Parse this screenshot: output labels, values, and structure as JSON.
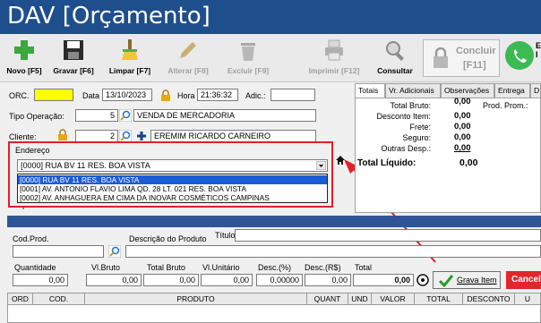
{
  "window": {
    "title": "DAV [Orçamento]"
  },
  "toolbar": {
    "novo": "Novo [F5]",
    "gravar": "Gravar [F6]",
    "limpar": "Limpar [F7]",
    "alterar": "Alterar [F8]",
    "excluir": "Excluir [F9]",
    "imprimir": "Imprimir [F12]",
    "consultar": "Consultar",
    "concluir_1": "Concluir",
    "concluir_2": "[F11]",
    "whatsapp_1": "E",
    "whatsapp_2": "I"
  },
  "form": {
    "orc_label": "ORC.",
    "orc_value": "",
    "data_label": "Data",
    "data_value": "13/10/2023",
    "hora_label": "Hora",
    "hora_value": "21:36:32",
    "adic_label": "Adic.:",
    "adic_value": "",
    "tipo_operacao_label": "Tipo Operação:",
    "tipo_operacao_code": "5",
    "tipo_operacao_desc": "VENDA DE MERCADORIA",
    "cliente_label": "Cliente:",
    "cliente_code": "2",
    "cliente_name": "EREMIM RICARDO CARNEIRO",
    "endereco_label": "Endereço",
    "endereco_selected": "[0000] RUA BV 11  RES. BOA VISTA",
    "endereco_options": [
      "[0000] RUA BV 11  RES. BOA VISTA",
      "[0001] AV. ANTONIO FLAVIO LIMA QD. 28 LT. 021 RES. BOA VISTA",
      "[0002] AV. ANHAGUERA EM CIMA DA INOVAR COSMÉTICOS CAMPINAS"
    ],
    "tipo_venda_label": "Tipo Venda:"
  },
  "tabs": {
    "items": [
      "Totais",
      "Vr. Adicionais",
      "Observações",
      "Entrega",
      "D"
    ],
    "total_bruto_label": "Total Bruto:",
    "total_bruto": "0,00",
    "prod_prom_label": "Prod. Prom.:",
    "desconto_item_label": "Desconto Item:",
    "desconto_item": "0,00",
    "frete_label": "Frete:",
    "frete": "0,00",
    "seguro_label": "Seguro:",
    "seguro": "0,00",
    "outras_label": "Outras Desp.:",
    "outras": "0,00",
    "total_liquido_label": "Total Líquido:",
    "total_liquido": "0,00"
  },
  "item": {
    "cod_prod_label": "Cod.Prod.",
    "descricao_label": "Descrição do Produto",
    "titulo_label": "Título",
    "quantidade_label": "Quantidade",
    "vl_bruto_label": "Vl.Bruto",
    "total_bruto_label": "Total Bruto",
    "vl_unitario_label": "Vl.Unitário",
    "desc_pct_label": "Desc.(%)",
    "desc_rs_label": "Desc.(R$)",
    "total_label": "Total",
    "quantidade": "0,00",
    "vl_bruto": "0,00",
    "total_bruto": "0,00",
    "vl_unitario": "0,00",
    "desc_pct": "0,00000",
    "desc_rs": "0,00",
    "total": "0,00",
    "grava_item": "Grava Item",
    "cancel": "Cancel"
  },
  "grid": {
    "columns": [
      "ORD",
      "COD.",
      "PRODUTO",
      "QUANT",
      "UND",
      "VALOR",
      "TOTAL",
      "DESCONTO",
      "U"
    ]
  },
  "colors": {
    "title_bg": "#1f4e8c",
    "highlight": "#e0202a",
    "selection": "#1a5bd6"
  }
}
